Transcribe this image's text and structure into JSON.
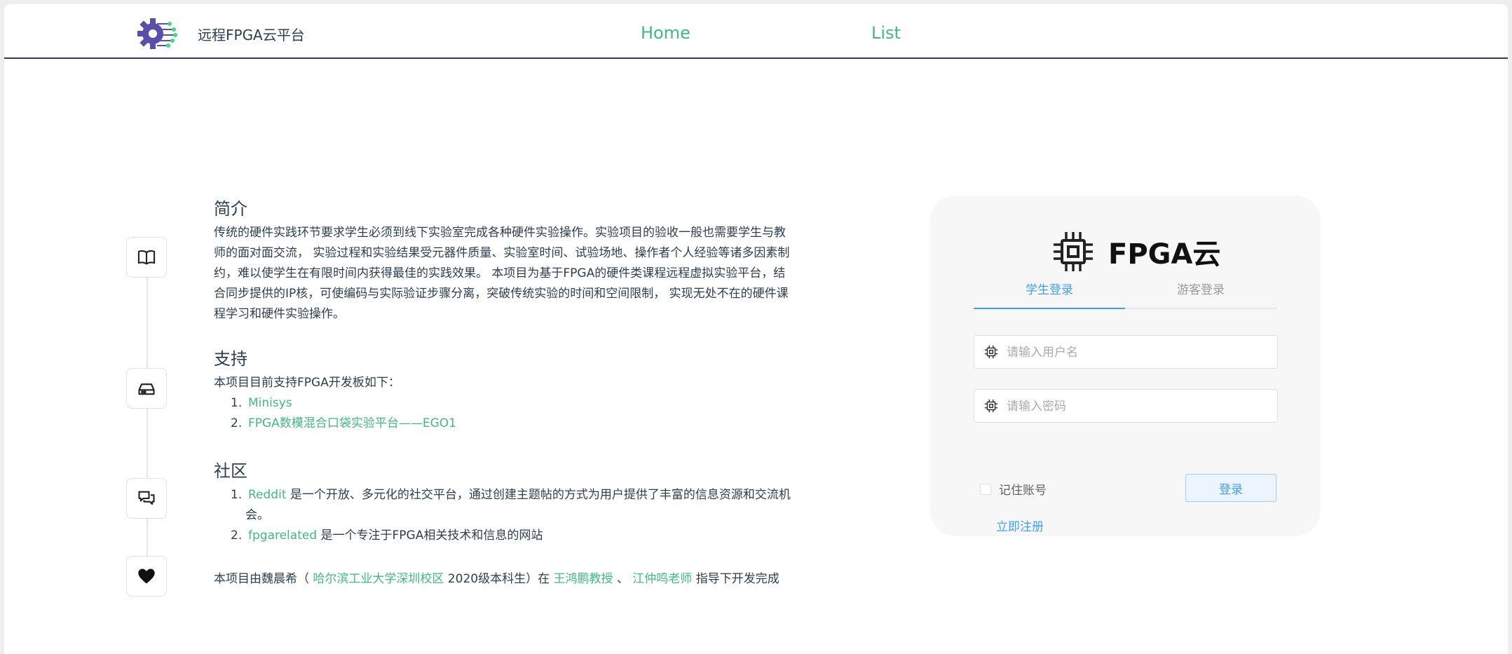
{
  "header": {
    "logo": "gear-circuit-logo",
    "site_title": "远程FPGA云平台",
    "nav": [
      {
        "label": "Home"
      },
      {
        "label": "List"
      }
    ]
  },
  "timeline": {
    "icons": [
      "book-icon",
      "router-icon",
      "chat-icon",
      "heart-icon"
    ]
  },
  "intro": {
    "heading": "简介",
    "lines": [
      "传统的硬件实践环节要求学生必须到线下实验室完成各种硬件实验操作。实验项目的验收一般也需要学生与教",
      "师的面对面交流， 实验过程和实验结果受元器件质量、实验室时间、试验场地、操作者个人经验等诸多因素制",
      "约，难以使学生在有限时间内获得最佳的实践效果。 本项目为基于FPGA的硬件类课程远程虚拟实验平台，结",
      "合同步提供的IP核，可使编码与实际验证步骤分离，突破传统实验的时间和空间限制， 实现无处不在的硬件课",
      "程学习和硬件实验操作。"
    ]
  },
  "support": {
    "heading": "支持",
    "text": "本项目目前支持FPGA开发板如下：",
    "items": [
      {
        "num": "1.",
        "link": "Minisys"
      },
      {
        "num": "2.",
        "link": "FPGA数模混合口袋实验平台——EGO1"
      }
    ]
  },
  "community": {
    "heading": "社区",
    "items": [
      {
        "num": "1.",
        "link": "Reddit",
        "text_1": " 是一个开放、多元化的社交平台，通过创建主题帖的方式为用户提供了丰富的信息资源和交流机",
        "text_2": "会。"
      },
      {
        "num": "2.",
        "link": "fpgarelated",
        "text_1": " 是一个专注于FPGA相关技术和信息的网站"
      }
    ]
  },
  "credits": {
    "prefix": "本项目由魏晨希（ ",
    "school": "哈尔滨工业大学深圳校区",
    "middle": " 2020级本科生）在 ",
    "advisor_1": "王鸿鹏教授",
    "sep": " 、 ",
    "advisor_2": "江仲鸣老师",
    "suffix": " 指导下开发完成"
  },
  "login": {
    "brand_icon": "chip-icon",
    "brand_text": "FPGA云",
    "tabs": [
      "学生登录",
      "游客登录"
    ],
    "active_tab": "学生登录",
    "username_placeholder": "请输入用户名",
    "password_placeholder": "请输入密码",
    "remember_label": "记住账号",
    "remember_checked": false,
    "login_button": "登录",
    "register_link": "立即注册"
  },
  "colors": {
    "link_green": "#42b983",
    "accent_blue": "#409eff",
    "text_dark": "#2c3e50",
    "card_bg": "#f7f7f8"
  }
}
